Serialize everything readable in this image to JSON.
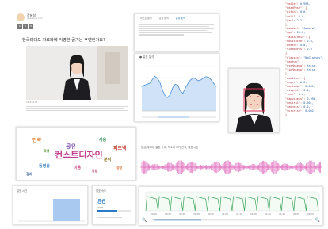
{
  "article": {
    "author": "장혜성",
    "author_sub": "@speakup.co.kr",
    "tags": [
      "1",
      "2",
      "3"
    ],
    "title": "한국외대도 자료화에 익명한 골기는 후엔인가요?",
    "caption": "2016.10.15"
  },
  "info_panel": {
    "tabs": [
      "텍스트 분석",
      "감정 분석",
      "음성 분석"
    ]
  },
  "chart_panel": {
    "header": "● 발표 분석",
    "chart_data": {
      "type": "area",
      "values": [
        0.55,
        0.58,
        0.6,
        0.62,
        0.7,
        0.78,
        0.74,
        0.65,
        0.48,
        0.35,
        0.3,
        0.36,
        0.52,
        0.6,
        0.58,
        0.45,
        0.4,
        0.52,
        0.62,
        0.7,
        0.75,
        0.72,
        0.68,
        0.7,
        0.74,
        0.77,
        0.76,
        0.7,
        0.62,
        0.55
      ],
      "ylim": [
        0,
        1
      ]
    }
  },
  "face_panel": {
    "box_color": "#e0305a"
  },
  "json_panel": {
    "lines": [
      [
        "\"smile\": ",
        "0.998,"
      ],
      [
        "\"headPose\": {",
        ""
      ],
      [
        "  \"pitch\": ",
        "0.0,"
      ],
      [
        "  \"roll\": ",
        "0.0,"
      ],
      [
        "  \"yaw\": ",
        "2.2"
      ],
      [
        "},",
        ""
      ],
      [
        "\"gender\": ",
        "\"female\","
      ],
      [
        "\"age\": ",
        "25.6,"
      ],
      [
        "\"facialHair\": {",
        ""
      ],
      [
        "  \"moustache\": ",
        "0.0,"
      ],
      [
        "  \"beard\": ",
        "0.0,"
      ],
      [
        "  \"sideburns\": ",
        "0.0"
      ],
      [
        "},",
        ""
      ],
      [
        "\"glasses\": ",
        "\"NoGlasses\","
      ],
      [
        "\"makeup\": {",
        ""
      ],
      [
        "  \"eyeMakeup\": ",
        "false,"
      ],
      [
        "  \"lipMakeup\": ",
        "false"
      ],
      [
        "},",
        ""
      ],
      [
        "\"emotion\": {",
        ""
      ],
      [
        "  \"anger\": ",
        "0.0,"
      ],
      [
        "  \"contempt\": ",
        "0.001,"
      ],
      [
        "  \"disgust\": ",
        "0.0,"
      ],
      [
        "  \"fear\": ",
        "0.0,"
      ],
      [
        "  \"happiness\": ",
        "0.998,"
      ],
      [
        "  \"neutral\": ",
        "0.001,"
      ],
      [
        "  \"sadness\": ",
        "0.0,"
      ],
      [
        "  \"surprise\": ",
        "0.002"
      ],
      [
        "}",
        ""
      ]
    ]
  },
  "word_cloud": {
    "words": [
      {
        "text": "컨스트디자인",
        "color": "#c23b8e",
        "size": 11
      },
      {
        "text": "공유",
        "color": "#7a4fb0",
        "size": 7
      },
      {
        "text": "전략",
        "color": "#e07a2b",
        "size": 6
      },
      {
        "text": "사용",
        "color": "#2f8c5a",
        "size": 5
      },
      {
        "text": "피드백",
        "color": "#c0392b",
        "size": 6
      },
      {
        "text": "동영상",
        "color": "#3b7fc4",
        "size": 5
      },
      {
        "text": "이용",
        "color": "#d04d8a",
        "size": 5
      },
      {
        "text": "분석",
        "color": "#8c6d1f",
        "size": 5
      },
      {
        "text": "학생",
        "color": "#5a9c3a",
        "size": 4
      },
      {
        "text": "방법",
        "color": "#b8457b",
        "size": 4
      },
      {
        "text": "성장",
        "color": "#d66a2c",
        "size": 4
      },
      {
        "text": "결과",
        "color": "#4a6fa8",
        "size": 4
      }
    ]
  },
  "waveform": {
    "header": "음성/데이터: 발표 속도, 목소리 크기/간격, 발표 시간",
    "color": "#d63fa8"
  },
  "timeline": {
    "ticks": [
      "00:10",
      "00:20",
      "00:30",
      "00:40",
      "00:50",
      "01:00",
      "01:10",
      "01:20",
      "01:30",
      "01:40",
      "01:50",
      "02:00"
    ],
    "color": "#3aa35a"
  },
  "stats": {
    "left_label": "발표 시간",
    "right_label": "발표 속도",
    "value": "86",
    "value_sub": "WPM"
  }
}
